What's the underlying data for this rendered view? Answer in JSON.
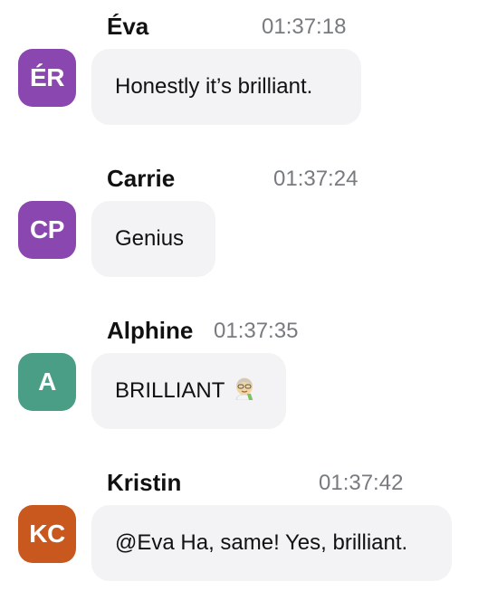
{
  "messages": [
    {
      "name": "Éva",
      "time": "01:37:18",
      "initials": "ÉR",
      "avatar_color": "#8b47b0",
      "text": "Honestly it’s brilliant."
    },
    {
      "name": "Carrie",
      "time": "01:37:24",
      "initials": "CP",
      "avatar_color": "#8b47b0",
      "text": "Genius"
    },
    {
      "name": "Alphine",
      "time": "01:37:35",
      "initials": "A",
      "avatar_color": "#4a9e85",
      "text": "BRILLIANT",
      "emoji": "scientist-emoji"
    },
    {
      "name": "Kristin",
      "time": "01:37:42",
      "initials": "KC",
      "avatar_color": "#c9581f",
      "text": "@Eva Ha, same! Yes, brilliant."
    }
  ]
}
